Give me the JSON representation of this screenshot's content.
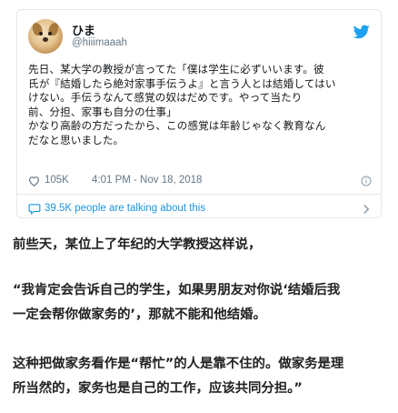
{
  "tweet": {
    "display_name": "ひま",
    "handle": "@hiiimaaah",
    "text_lines": [
      "先日、某大学の教授が言ってた「僕は学生に必ずいいます。彼",
      "氏が『結婚したら絶対家事手伝うよ』と言う人とは結婚してはい",
      "けない。手伝うなんて感覚の奴はだめです。やって当たり",
      "前、分担、家事も自分の仕事」",
      "かなり高齢の方だったから、この感覚は年齢じゃなく教育なん",
      "だなと思いました。"
    ],
    "like_count": "105K",
    "timestamp": "4:01 PM - Nov 18, 2018",
    "people_talking": "39.5K people are talking about this",
    "icons": {
      "brand": "twitter-bird-icon",
      "like": "heart-icon",
      "info": "info-icon",
      "conversation": "speech-bubble-icon",
      "more": "chevron-right-icon"
    },
    "colors": {
      "brand_blue": "#1da1f2",
      "link_blue": "#1b95e0",
      "muted": "#657786",
      "border": "#e1e8ed"
    }
  },
  "article": {
    "paragraph1": [
      "前些天，某位上了年纪的大学教授这样说，"
    ],
    "paragraph2": [
      "“我肯定会告诉自己的学生，如果男朋友对你说‘结婚后我",
      "一定会帮你做家务的’，那就不能和他结婚。"
    ],
    "paragraph3": [
      "这种把做家务看作是“帮忙”的人是靠不住的。做家务是理",
      "所当然的，家务也是自己的工作，应该共同分担。”"
    ]
  }
}
